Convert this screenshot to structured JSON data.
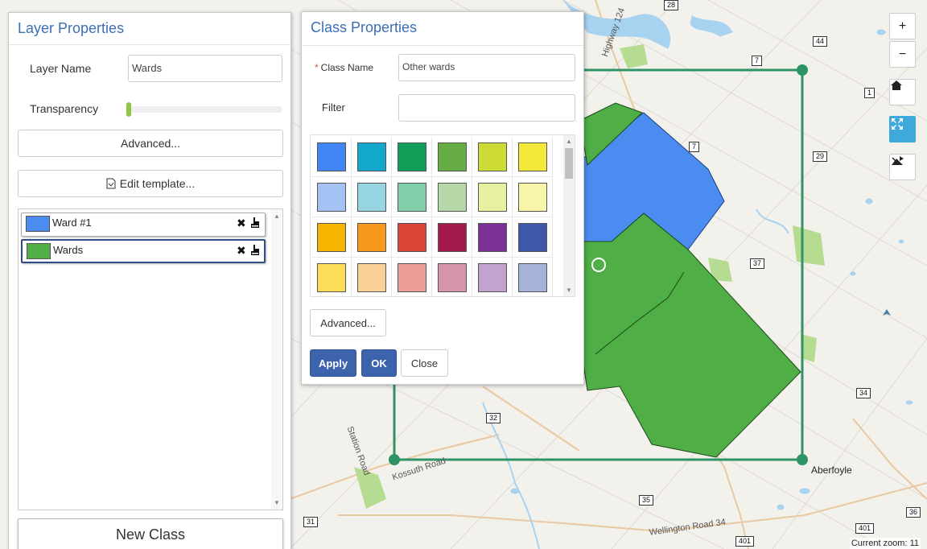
{
  "map": {
    "roads": [
      {
        "label": "Highway 124"
      },
      {
        "label": "Kossuth Road"
      },
      {
        "label": "Wellington Road 34"
      },
      {
        "label": "Station Road"
      }
    ],
    "shields": [
      "28",
      "44",
      "7",
      "1",
      "7",
      "29",
      "37",
      "32",
      "34",
      "31",
      "35",
      "401",
      "401",
      "36"
    ],
    "place": "Aberfoyle",
    "zoom_text": "Current zoom: 11",
    "colors": {
      "water": "#a8d3f0",
      "park": "#b6dc91",
      "ward_blue": "#4a8cf0",
      "ward_green": "#4fae46",
      "selection": "#2e9466"
    }
  },
  "map_controls": {
    "zoom_in": "+",
    "zoom_out": "−",
    "home_icon": "home-icon",
    "fullscreen_icon": "fullscreen-icon",
    "layers_icon": "layers-icon"
  },
  "layer_panel": {
    "title": "Layer Properties",
    "layer_name_label": "Layer Name",
    "layer_name_value": "Wards",
    "transparency_label": "Transparency",
    "transparency_value": 0,
    "advanced_label": "Advanced...",
    "edit_template_label": "Edit template...",
    "classes": [
      {
        "name": "Ward #1",
        "color": "#4a8cf0",
        "selected": false
      },
      {
        "name": "Wards",
        "color": "#4fae46",
        "selected": true
      }
    ],
    "new_class_label": "New Class"
  },
  "class_panel": {
    "title": "Class Properties",
    "required_mark": "*",
    "class_name_label": "Class Name",
    "class_name_value": "Other wards",
    "filter_label": "Filter",
    "filter_value": "",
    "palette": [
      [
        "#4285f4",
        "#11a8cc",
        "#0f9d58",
        "#67ad45",
        "#cddb36",
        "#f4e93a"
      ],
      [
        "#a4c2f4",
        "#97d5e3",
        "#80ceaa",
        "#b6d7a8",
        "#e6f0a0",
        "#f8f5a8"
      ],
      [
        "#f4b400",
        "#f8981d",
        "#db4437",
        "#a3194b",
        "#7b3297",
        "#3f57a8"
      ],
      [
        "#fddd58",
        "#f9d096",
        "#ec9d97",
        "#d596aa",
        "#c4a2d0",
        "#a6b3d9"
      ]
    ],
    "advanced_label": "Advanced...",
    "apply_label": "Apply",
    "ok_label": "OK",
    "close_label": "Close"
  }
}
